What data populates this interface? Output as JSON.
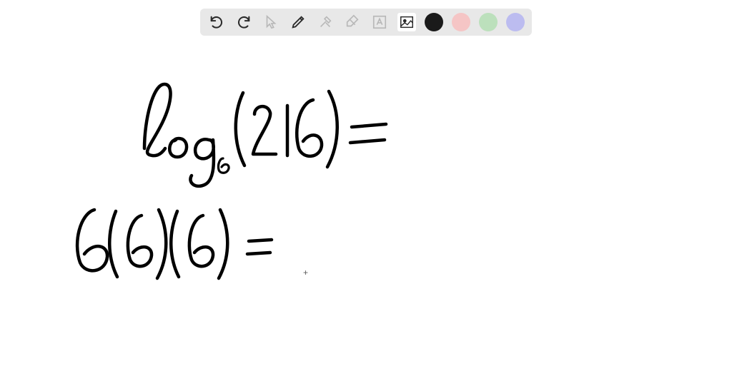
{
  "toolbar": {
    "tools": [
      {
        "name": "undo-icon",
        "interactable": true,
        "active": true
      },
      {
        "name": "redo-icon",
        "interactable": true,
        "active": true
      },
      {
        "name": "pointer-icon",
        "interactable": true,
        "active": false
      },
      {
        "name": "pencil-icon",
        "interactable": true,
        "active": true
      },
      {
        "name": "tools-icon",
        "interactable": true,
        "active": false
      },
      {
        "name": "eraser-icon",
        "interactable": true,
        "active": false
      },
      {
        "name": "text-icon",
        "interactable": true,
        "active": false
      },
      {
        "name": "image-icon",
        "interactable": true,
        "active": true,
        "selected": true
      }
    ],
    "colors": [
      {
        "name": "black",
        "hex": "#1a1a1a"
      },
      {
        "name": "pink",
        "hex": "#f5c5c5"
      },
      {
        "name": "green",
        "hex": "#bce0bc"
      },
      {
        "name": "purple",
        "hex": "#bcbcf0"
      }
    ]
  },
  "handwriting": {
    "line1": "log₆(216) =",
    "line2": "6(6)(6) ="
  },
  "cursor": "+"
}
